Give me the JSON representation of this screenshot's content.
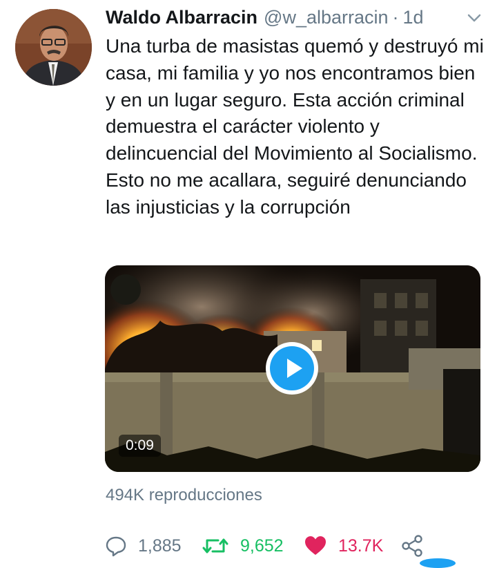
{
  "tweet": {
    "author_name": "Waldo Albarracin",
    "handle": "@w_albarracin",
    "separator": "·",
    "time": "1d",
    "text": "Una turba de masistas quemó y destruyó mi casa, mi familia y yo nos encontramos bien y en un lugar seguro. Esta acción criminal demuestra el carácter violento y delincuencial del Movimiento al Socialismo. Esto no me acallara, seguiré denunciando las injusticias y la corrupción",
    "video": {
      "duration": "0:09",
      "views": "494K reproducciones"
    },
    "actions": {
      "replies": "1,885",
      "retweets": "9,652",
      "likes": "13.7K"
    }
  },
  "icons": {
    "menu": "chevron-down-icon",
    "play": "play-icon",
    "reply": "reply-icon",
    "retweet": "retweet-icon",
    "like": "heart-icon",
    "share": "share-icon"
  },
  "colors": {
    "text": "#14171a",
    "secondary": "#657786",
    "accent": "#1da1f2",
    "retweet": "#17bf63",
    "like": "#e0245e"
  }
}
